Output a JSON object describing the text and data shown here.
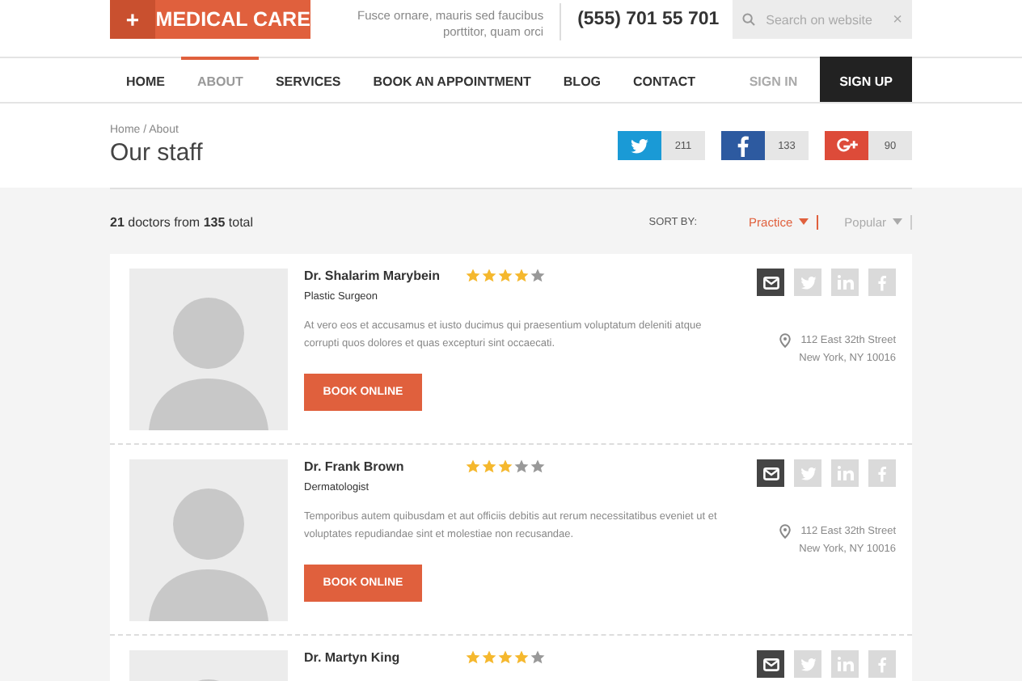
{
  "logo": {
    "symbol": "+",
    "name": "MEDICAL CARE"
  },
  "tagline": "Fusce ornare, mauris sed faucibus porttitor, quam orci",
  "phone": "(555) 701 55 701",
  "search": {
    "placeholder": "Search on website",
    "clear": "×"
  },
  "nav": [
    {
      "label": "HOME",
      "selected": false
    },
    {
      "label": "ABOUT",
      "selected": true
    },
    {
      "label": "SERVICES",
      "selected": false
    },
    {
      "label": "BOOK AN APPOINTMENT",
      "selected": false
    },
    {
      "label": "BLOG",
      "selected": false
    },
    {
      "label": "CONTACT",
      "selected": false
    }
  ],
  "auth": {
    "sign_in": "SIGN IN",
    "sign_up": "SIGN UP"
  },
  "breadcrumb": "Home / About",
  "page_title": "Our staff",
  "shares": [
    {
      "kind": "twitter",
      "count": "211",
      "color": "#1a9ad6"
    },
    {
      "kind": "facebook",
      "count": "133",
      "color": "#2d5aa0"
    },
    {
      "kind": "gplus",
      "count": "90",
      "color": "#dd4b39"
    }
  ],
  "summary": "**21** doctors from **135** total",
  "sort": {
    "label": "SORT BY:",
    "options": [
      {
        "label": "Practice",
        "selected": true
      },
      {
        "label": "Popular",
        "selected": false
      }
    ]
  },
  "doctors": [
    {
      "name": "Dr. Shalarim Marybein",
      "stars": 4,
      "specialty": "Plastic Surgeon",
      "bio": "At vero eos et accusamus et iusto ducimus qui praesentium voluptatum deleniti atque corrupti quos dolores et quas excepturi sint occaecati.",
      "address": [
        "112 East 32th Street",
        "New York, NY 10016"
      ],
      "button": "BOOK ONLINE"
    },
    {
      "name": "Dr. Frank Brown",
      "stars": 3,
      "specialty": "Dermatologist",
      "bio": "Temporibus autem quibusdam et aut officiis debitis aut rerum necessitatibus eveniet ut et voluptates repudiandae sint et molestiae non recusandae.",
      "address": [
        "112 East 32th Street",
        "New York, NY 10016"
      ],
      "button": "BOOK ONLINE"
    },
    {
      "name": "Dr. Martyn King",
      "stars": 4
    }
  ]
}
